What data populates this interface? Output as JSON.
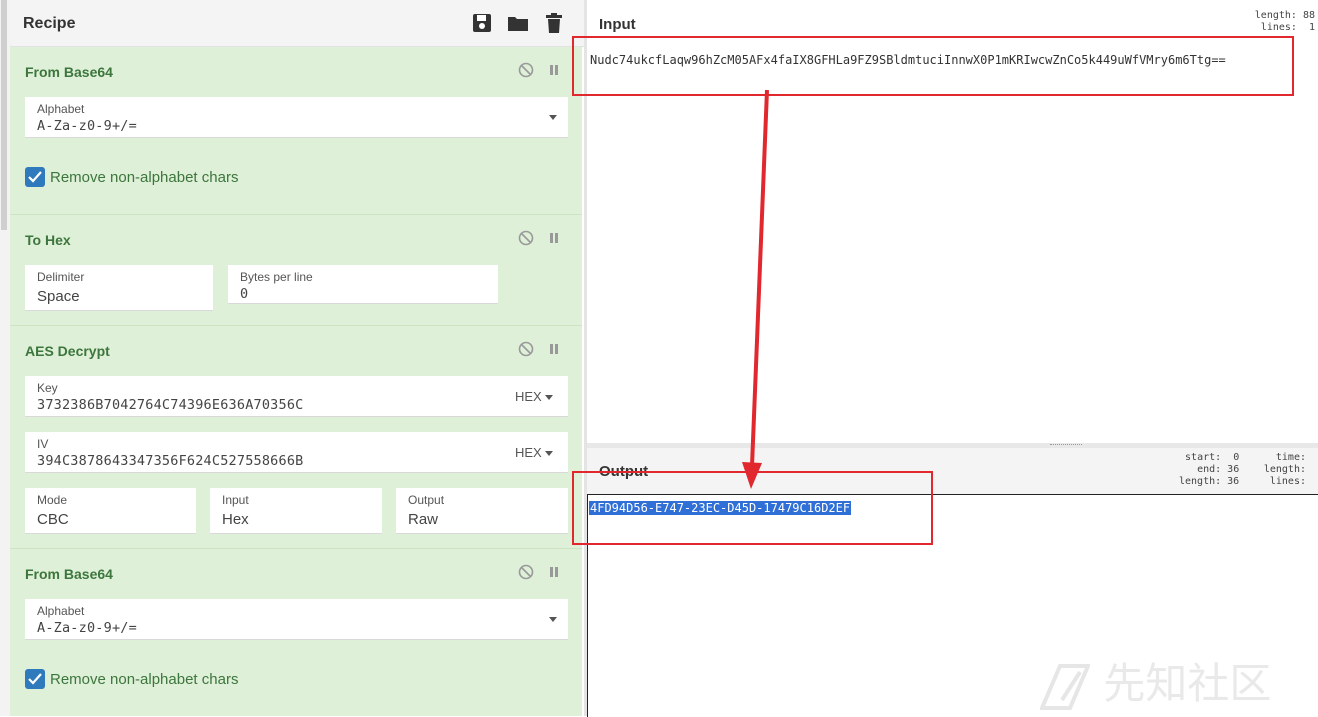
{
  "recipe": {
    "title": "Recipe",
    "operations": [
      {
        "name": "From Base64",
        "alphabet_label": "Alphabet",
        "alphabet_value": "A-Za-z0-9+/=",
        "checkbox_label": "Remove non-alphabet chars",
        "checkbox_checked": true
      },
      {
        "name": "To Hex",
        "delimiter_label": "Delimiter",
        "delimiter_value": "Space",
        "bytes_label": "Bytes per line",
        "bytes_value": "0"
      },
      {
        "name": "AES Decrypt",
        "key_label": "Key",
        "key_value": "3732386B7042764C74396E636A70356C",
        "key_format": "HEX",
        "iv_label": "IV",
        "iv_value": "394C3878643347356F624C527558666B",
        "iv_format": "HEX",
        "mode_label": "Mode",
        "mode_value": "CBC",
        "input_label": "Input",
        "input_value": "Hex",
        "output_label": "Output",
        "output_value": "Raw"
      },
      {
        "name": "From Base64",
        "alphabet_label": "Alphabet",
        "alphabet_value": "A-Za-z0-9+/=",
        "checkbox_label": "Remove non-alphabet chars",
        "checkbox_checked": true
      }
    ]
  },
  "input": {
    "title": "Input",
    "stats": "length: 88\n lines:  1",
    "text": "Nudc74ukcfLaqw96hZcM05AFx4faIX8GFHLa9FZ9SBldmtuciInnwX0P1mKRIwcwZnCo5k449uWfVMry6m6Ttg=="
  },
  "output": {
    "title": "Output",
    "stats_left": "start:  0\n  end: 36\nlength: 36",
    "stats_right": "time:\nlength:\nlines:",
    "text": "4FD94D56-E747-23EC-D45D-17479C16D2EF"
  },
  "watermark": "先知社区",
  "colors": {
    "op_background": "#dff0d8",
    "op_title": "#3c763d",
    "checkbox": "#2e7abd",
    "selection": "#2f6fd6",
    "annotation_red": "#e0282e"
  }
}
